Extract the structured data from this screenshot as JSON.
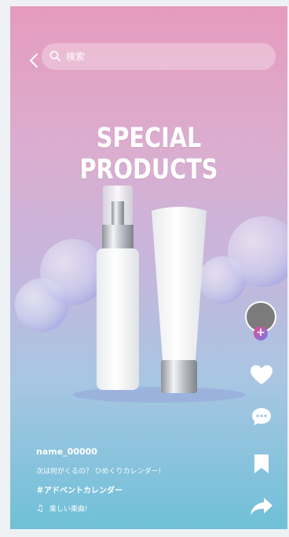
{
  "search": {
    "placeholder": "検索"
  },
  "headline": "SPECIAL PRODUCTS",
  "post": {
    "username": "name_00000",
    "description": "次は何がくるの？ ひめくりカレンダー!",
    "hashtag": "＃アドベントカレンダー",
    "music": "楽しい楽曲!"
  },
  "icons": {
    "back": "chevron-left-icon",
    "search": "search-icon",
    "follow": "plus-icon",
    "like": "heart-icon",
    "comment": "comment-icon",
    "save": "bookmark-icon",
    "share": "share-icon",
    "music": "music-note-icon"
  },
  "colors": {
    "gradient_top": "#e59bbd",
    "gradient_bottom": "#6fc0d8",
    "text": "#ffffff",
    "avatar": "#7b7b7b"
  }
}
